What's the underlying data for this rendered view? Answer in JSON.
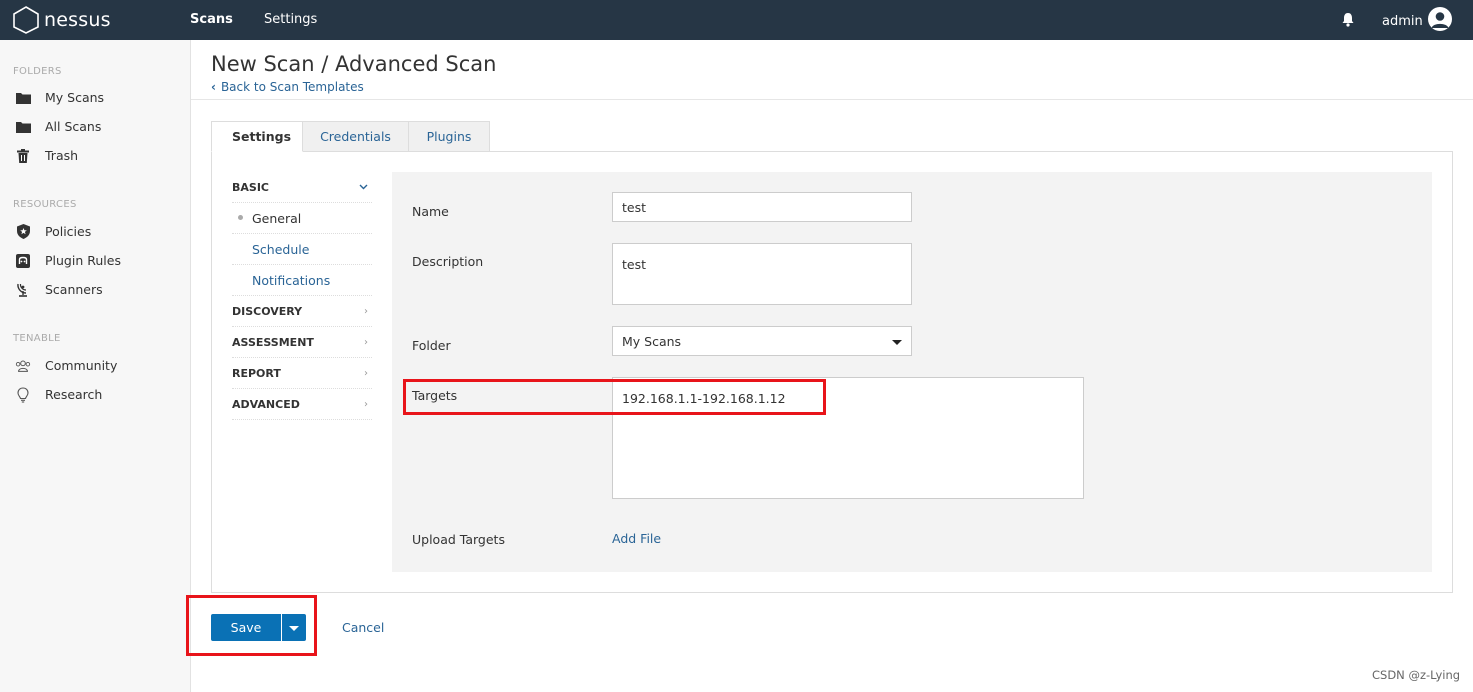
{
  "app": {
    "logo_text": "nessus",
    "nav": [
      {
        "label": "Scans",
        "active": true
      },
      {
        "label": "Settings",
        "active": false
      }
    ],
    "user": "admin"
  },
  "sidebar": {
    "sections": [
      {
        "title": "FOLDERS",
        "items": [
          {
            "label": "My Scans",
            "icon": "folder-icon"
          },
          {
            "label": "All Scans",
            "icon": "folder-icon"
          },
          {
            "label": "Trash",
            "icon": "trash-icon"
          }
        ]
      },
      {
        "title": "RESOURCES",
        "items": [
          {
            "label": "Policies",
            "icon": "shield-star-icon"
          },
          {
            "label": "Plugin Rules",
            "icon": "plugin-rules-icon"
          },
          {
            "label": "Scanners",
            "icon": "scanner-icon"
          }
        ]
      },
      {
        "title": "TENABLE",
        "items": [
          {
            "label": "Community",
            "icon": "community-icon"
          },
          {
            "label": "Research",
            "icon": "lightbulb-icon"
          }
        ]
      }
    ]
  },
  "page": {
    "title": "New Scan / Advanced Scan",
    "back_link": "Back to Scan Templates"
  },
  "tabs": [
    {
      "label": "Settings",
      "active": true
    },
    {
      "label": "Credentials",
      "active": false
    },
    {
      "label": "Plugins",
      "active": false
    }
  ],
  "settings_nav": {
    "basic": "BASIC",
    "basic_items": [
      {
        "label": "General",
        "current": true
      },
      {
        "label": "Schedule",
        "current": false
      },
      {
        "label": "Notifications",
        "current": false
      }
    ],
    "sections": [
      "DISCOVERY",
      "ASSESSMENT",
      "REPORT",
      "ADVANCED"
    ]
  },
  "form": {
    "name_label": "Name",
    "name_value": "test",
    "description_label": "Description",
    "description_value": "test",
    "folder_label": "Folder",
    "folder_value": "My Scans",
    "targets_label": "Targets",
    "targets_value": "192.168.1.1-192.168.1.12",
    "upload_label": "Upload Targets",
    "add_file": "Add File"
  },
  "actions": {
    "save": "Save",
    "cancel": "Cancel"
  },
  "watermark": "CSDN @z-Lying",
  "colors": {
    "topbar": "#263645",
    "primary": "#0a71b5",
    "link": "#2a6496",
    "highlight": "#e8141a"
  }
}
